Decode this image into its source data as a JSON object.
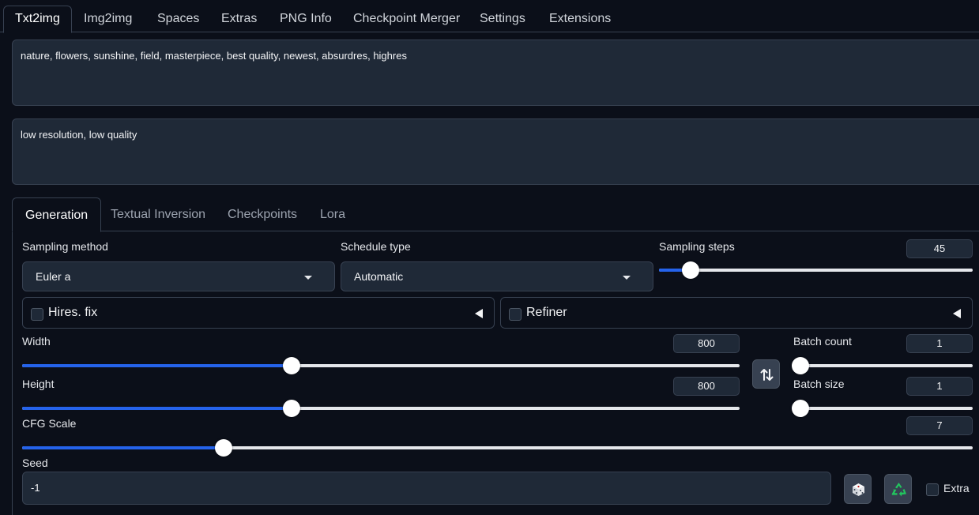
{
  "top_tabs": [
    "Txt2img",
    "Img2img",
    "Spaces",
    "Extras",
    "PNG Info",
    "Checkpoint Merger",
    "Settings",
    "Extensions"
  ],
  "prompt": {
    "positive": "nature, flowers, sunshine, field, masterpiece, best quality, newest, absurdres, highres",
    "negative": "low resolution, low quality"
  },
  "sub_tabs": [
    "Generation",
    "Textual Inversion",
    "Checkpoints",
    "Lora"
  ],
  "sampling_method": {
    "label": "Sampling method",
    "value": "Euler a"
  },
  "schedule_type": {
    "label": "Schedule type",
    "value": "Automatic"
  },
  "sampling_steps": {
    "label": "Sampling steps",
    "value": "45",
    "fraction": 0.1
  },
  "hires_fix": {
    "label": "Hires. fix",
    "checked": false
  },
  "refiner": {
    "label": "Refiner",
    "checked": false
  },
  "width": {
    "label": "Width",
    "value": "800",
    "fraction": 0.375
  },
  "height": {
    "label": "Height",
    "value": "800",
    "fraction": 0.375
  },
  "batch_count": {
    "label": "Batch count",
    "value": "1",
    "fraction": 0
  },
  "batch_size": {
    "label": "Batch size",
    "value": "1",
    "fraction": 0
  },
  "cfg_scale": {
    "label": "CFG Scale",
    "value": "7",
    "fraction": 0.212
  },
  "seed": {
    "label": "Seed",
    "value": "-1",
    "extra_label": "Extra"
  },
  "icons": {
    "swap": "swap-dimensions-icon",
    "dice": "dice-icon",
    "recycle": "recycle-icon"
  },
  "colors": {
    "accent": "#2563eb",
    "background": "#0b0f19",
    "surface": "#1f2937"
  }
}
